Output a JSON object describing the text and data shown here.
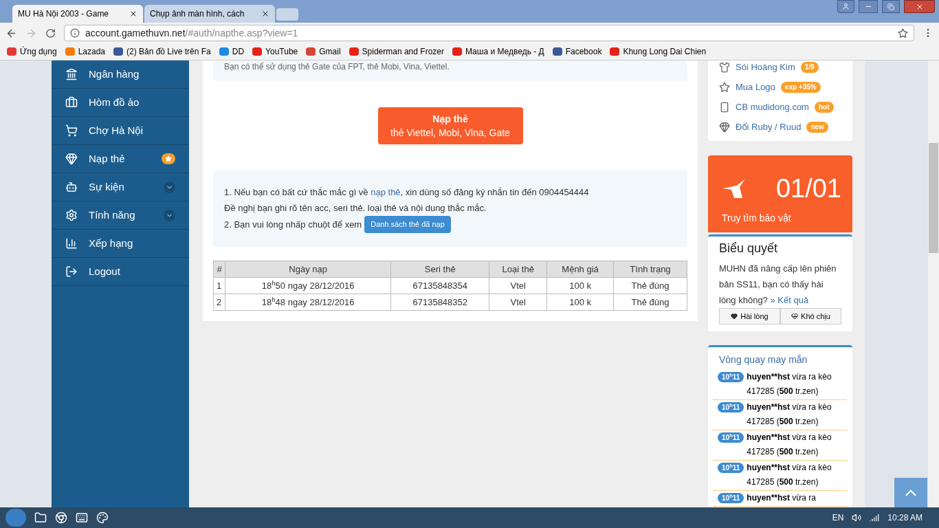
{
  "browser": {
    "tabs": [
      {
        "title": "MU Hà Nội 2003 - Game",
        "selected": true
      },
      {
        "title": "Chụp ảnh màn hình, cách",
        "selected": false
      }
    ],
    "address": {
      "host": "account.gamethuvn.net",
      "path": "/#auth/napthe.asp?view=1"
    },
    "bookmarks": [
      "Ứng dụng",
      "Lazada",
      "(2) Bản đồ Live trên Fa",
      "DD",
      "YouTube",
      "Gmail",
      "Spiderman and Frozer",
      "Маша и Медведь - Д",
      "Facebook",
      "Khung Long Dai Chien"
    ]
  },
  "sidebar": {
    "items": [
      {
        "label": "Ngân hàng",
        "kind": "plain"
      },
      {
        "label": "Hòm đồ ảo",
        "kind": "plain"
      },
      {
        "label": "Chợ Hà Nội",
        "kind": "plain"
      },
      {
        "label": "Nạp thẻ",
        "kind": "starred"
      },
      {
        "label": "Sự kiện",
        "kind": "expandable"
      },
      {
        "label": "Tính năng",
        "kind": "expandable"
      },
      {
        "label": "Xếp hạng",
        "kind": "plain"
      },
      {
        "label": "Logout",
        "kind": "plain"
      }
    ]
  },
  "main": {
    "notice": "Bạn có thể sử dụng thẻ Gate của FPT, thẻ Mobi, Vina, Viettel.",
    "topup_button": {
      "title": "Nạp thẻ",
      "subtitle": "thẻ Viettel, Mobi, Vina, Gate"
    },
    "info": {
      "line1_before": "1. Nếu bạn có bất cứ thắc mắc gì về",
      "line1_link": "nạp thẻ",
      "line1_after": ", xin dùng số đăng ký nhắn tin đến 0904454444",
      "line2": "Đề nghị bạn ghi rõ tên acc, seri thẻ. loại thẻ và nội dung thắc mắc.",
      "line3": "2. Bạn vui lòng nhấp chuột để xem",
      "list_button": "Danh sách thẻ đã nạp"
    },
    "table": {
      "columns": [
        "#",
        "Ngày nạp",
        "Seri thẻ",
        "Loại thẻ",
        "Mệnh giá",
        "Tình trạng"
      ],
      "rows": [
        [
          "1",
          "18$^{h}$50 ngay 28/12/2016",
          "67135848354",
          "Vtel",
          "100 k",
          "Thẻ đúng"
        ],
        [
          "2",
          "18$^{h}$48 ngay 28/12/2016",
          "67135848352",
          "Vtel",
          "100 k",
          "Thẻ đúng"
        ]
      ]
    }
  },
  "right": {
    "links": [
      {
        "label": "Sói Hoàng Kim",
        "badge": "1/9"
      },
      {
        "label": "Mua Logo",
        "badge": "exp +35%"
      },
      {
        "label": "CB mudidong.com",
        "badge": "hot"
      },
      {
        "label": "Đổi Ruby / Ruud",
        "badge": "new"
      }
    ],
    "treasure": {
      "count": "01/01",
      "label": "Truy tìm bảo vật"
    },
    "vote": {
      "title": "Biểu quyết",
      "question": "MUHN đã nâng cấp lên phiên bản SS11, bạn có thấy hài lòng không?",
      "result_link": "» Kết quả",
      "buttons": [
        "Hài lòng",
        "Khó chịu"
      ]
    },
    "wheel": {
      "title": "Vòng quay may mắn",
      "entries": [
        {
          "time": "10$^{h}$11",
          "user": "huyen**hst",
          "text": "vừa ra kèo 417285 (**500** tr.zen)"
        },
        {
          "time": "10$^{h}$11",
          "user": "huyen**hst",
          "text": "vừa ra kèo 417285 (**500** tr.zen)"
        },
        {
          "time": "10$^{h}$11",
          "user": "huyen**hst",
          "text": "vừa ra kèo 417285 (**500** tr.zen)"
        },
        {
          "time": "10$^{h}$11",
          "user": "huyen**hst",
          "text": "vừa ra kèo 417285 (**500** tr.zen)"
        },
        {
          "time": "10$^{h}$11",
          "user": "huyen**hst",
          "text": "vừa ra"
        }
      ]
    }
  },
  "taskbar": {
    "language": "EN",
    "clock": "10:28 AM"
  }
}
